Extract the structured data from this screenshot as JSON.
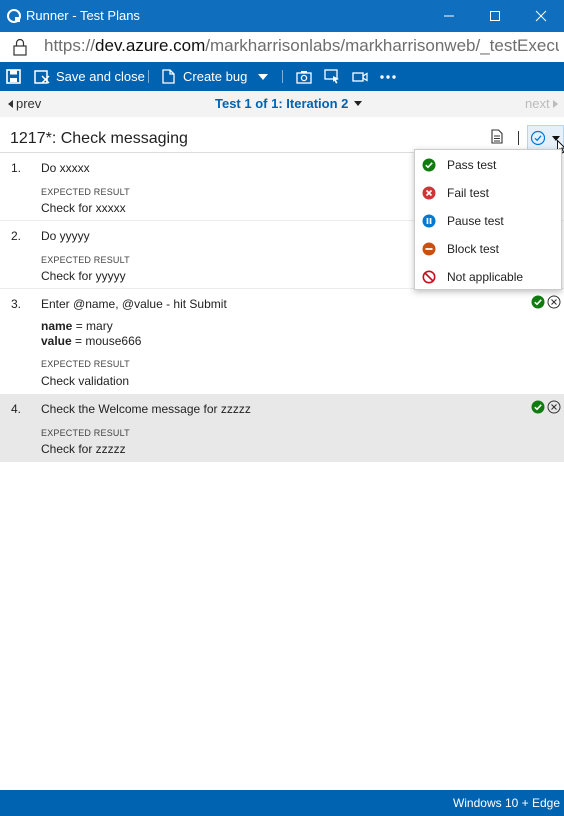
{
  "window": {
    "title": "Runner - Test Plans",
    "url_prefix": "https://",
    "url_host": "dev.azure.com",
    "url_path": "/markharrisonlabs/markharrisonweb/_testExecu..."
  },
  "toolbar": {
    "save_close_label": "Save and close",
    "create_bug_label": "Create bug"
  },
  "nav": {
    "prev_label": "prev",
    "iteration_label": "Test 1 of 1: Iteration 2",
    "next_label": "next"
  },
  "test_case": {
    "title": "1217*: Check messaging"
  },
  "steps": [
    {
      "number": "1.",
      "action": "Do xxxxx",
      "expected_label": "EXPECTED RESULT",
      "expected": "Check for xxxxx"
    },
    {
      "number": "2.",
      "action": "Do yyyyy",
      "expected_label": "EXPECTED RESULT",
      "expected": "Check for yyyyy"
    },
    {
      "number": "3.",
      "action": "Enter @name, @value - hit Submit",
      "params": [
        {
          "name": "name",
          "value": "mary"
        },
        {
          "name": "value",
          "value": "mouse666"
        }
      ],
      "expected_label": "EXPECTED RESULT",
      "expected": "Check validation"
    },
    {
      "number": "4.",
      "action": "Check the Welcome message for zzzzz",
      "expected_label": "EXPECTED RESULT",
      "expected": "Check for zzzzz"
    }
  ],
  "outcome_menu": {
    "items": [
      {
        "label": "Pass test",
        "icon": "pass-icon",
        "color": "#107c10"
      },
      {
        "label": "Fail test",
        "icon": "fail-icon",
        "color": "#d13438"
      },
      {
        "label": "Pause test",
        "icon": "pause-icon",
        "color": "#0078d4"
      },
      {
        "label": "Block test",
        "icon": "block-icon",
        "color": "#ca5010"
      },
      {
        "label": "Not applicable",
        "icon": "not-applicable-icon",
        "color": "#c50f1f"
      }
    ]
  },
  "footer": {
    "platform": "Windows 10 + Edge"
  },
  "colors": {
    "accent": "#0063b1",
    "title_bar": "#106ebe",
    "selected_row": "#e8e8e8"
  }
}
